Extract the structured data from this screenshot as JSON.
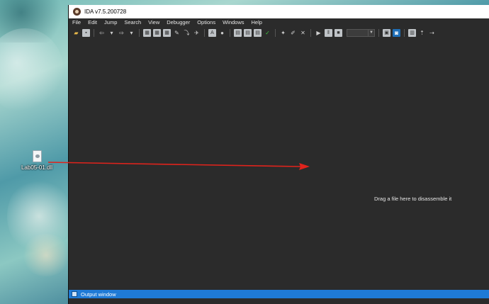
{
  "window": {
    "title": "IDA v7.5.200728"
  },
  "menu": [
    "File",
    "Edit",
    "Jump",
    "Search",
    "View",
    "Debugger",
    "Options",
    "Windows",
    "Help"
  ],
  "desktop": {
    "file_name": "Lab05-01.dll"
  },
  "main": {
    "drag_hint": "Drag a file here to disassemble it"
  },
  "output": {
    "label": "Output window"
  },
  "colors": {
    "accent": "#1f7ad6",
    "arrow": "#e0231c",
    "workspace": "#2b2b2b"
  }
}
